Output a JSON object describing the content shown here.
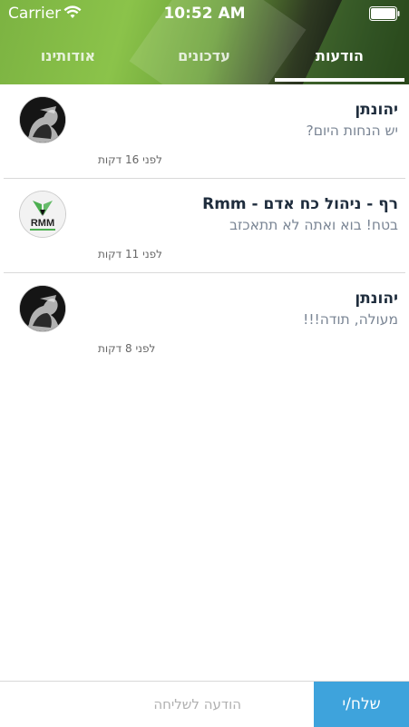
{
  "status_bar": {
    "carrier": "Carrier",
    "time": "10:52 AM"
  },
  "tabs": [
    {
      "label": "אודותינו"
    },
    {
      "label": "עדכונים"
    },
    {
      "label": "הודעות"
    }
  ],
  "messages": [
    {
      "sender": "יהונתן",
      "text": "יש הנחות היום?",
      "time": "לפני 16 דקות",
      "avatar": "photo"
    },
    {
      "sender": "רף - ניהול כח אדם  - Rmm",
      "text": "בטח! בוא ואתה לא תתאכזב",
      "time": "לפני 11 דקות",
      "avatar": "RMM"
    },
    {
      "sender": "יהונתן",
      "text": "מעולה, תודה!!!",
      "time": "לפני 8 דקות",
      "avatar": "photo"
    }
  ],
  "compose": {
    "placeholder": "הודעה לשליחה",
    "send_label": "שלח/י"
  },
  "colors": {
    "accent": "#3ea3dc",
    "header_green": "#7cb342"
  }
}
